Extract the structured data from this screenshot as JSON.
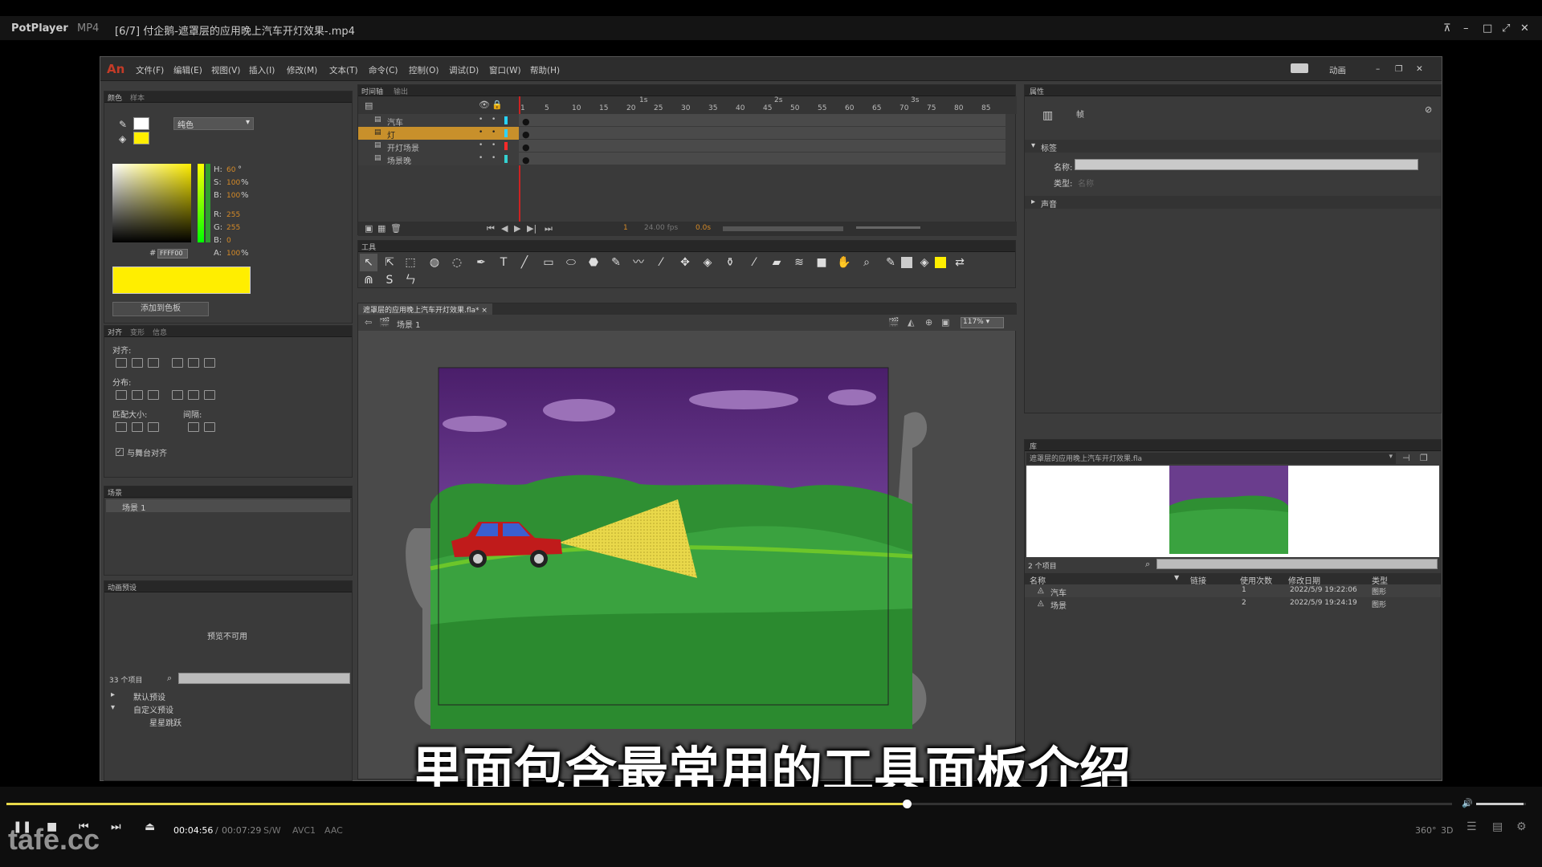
{
  "player": {
    "app_name": "PotPlayer",
    "format": "MP4",
    "file_title": "[6/7] 付企鹅-遮罩层的应用晚上汽车开灯效果-.mp4",
    "current_time": "00:04:56",
    "separator": "/",
    "total_time": "00:07:29",
    "tags": [
      "S/W",
      "AVC1",
      "AAC"
    ],
    "progress": 0.62,
    "volume": 0.95,
    "right_icons": [
      "360°",
      "3D"
    ],
    "subtitle": "里面包含最常用的工具面板介绍",
    "watermark": "tafe.cc"
  },
  "flash": {
    "logo": "An",
    "menus": [
      "文件(F)",
      "编辑(E)",
      "视图(V)",
      "插入(I)",
      "修改(M)",
      "文本(T)",
      "命令(C)",
      "控制(O)",
      "调试(D)",
      "窗口(W)",
      "帮助(H)"
    ],
    "workspace": "动画",
    "color_panel": {
      "tabs": [
        "颜色",
        "样本"
      ],
      "type": "纯色",
      "hsb": [
        {
          "k": "H:",
          "v": "60",
          "u": "°"
        },
        {
          "k": "S:",
          "v": "100",
          "u": "%"
        },
        {
          "k": "B:",
          "v": "100",
          "u": "%"
        }
      ],
      "rgb": [
        {
          "k": "R:",
          "v": "255"
        },
        {
          "k": "G:",
          "v": "255"
        },
        {
          "k": "B:",
          "v": "0"
        }
      ],
      "alpha": {
        "k": "A:",
        "v": "100",
        "u": "%"
      },
      "hex_label": "#",
      "hex": "FFFF00",
      "swatch_color": "#ffee00",
      "add_button": "添加到色板"
    },
    "align_panel": {
      "tabs": [
        "对齐",
        "变形",
        "信息"
      ],
      "align": "对齐:",
      "distribute": "分布:",
      "match_size": "匹配大小:",
      "spacing": "间隔:",
      "stage_align": "与舞台对齐"
    },
    "scene_panel": {
      "title": "场景",
      "item": "场景 1"
    },
    "motion_panel": {
      "title": "动画预设",
      "preview": "预览不可用",
      "count": "33 个项目",
      "tree": [
        "默认预设",
        "自定义预设",
        "星星跳跃"
      ]
    },
    "timeline": {
      "tabs": [
        "时间轴",
        "输出"
      ],
      "ticks": [
        "1",
        "5",
        "10",
        "15",
        "20",
        "25",
        "30",
        "35",
        "40",
        "45",
        "50",
        "55",
        "60",
        "65",
        "70",
        "75",
        "80",
        "85"
      ],
      "seconds": [
        "1s",
        "2s",
        "3s"
      ],
      "layers": [
        {
          "name": "汽车",
          "color": "#27d3ff"
        },
        {
          "name": "灯",
          "color": "#2fd3ff",
          "selected": true
        },
        {
          "name": "开灯场景",
          "color": "#ff2a2a"
        },
        {
          "name": "场景晚",
          "color": "#34d1d1"
        }
      ],
      "frame_num": "1",
      "fps": "24.00 fps",
      "time": "0.0s"
    },
    "tools_title": "工具",
    "doc_tab": "遮罩层的应用晚上汽车开灯效果.fla*",
    "scene_label": "场景 1",
    "zoom": "117%",
    "properties": {
      "title": "属性",
      "kind": "帧",
      "label_section": "标签",
      "name_label": "名称:",
      "type_label": "类型:",
      "type_value": "名称",
      "sound_section": "声音"
    },
    "library": {
      "title": "库",
      "file": "遮罩层的应用晚上汽车开灯效果.fla",
      "count": "2 个项目",
      "headers": [
        "名称",
        "链接",
        "使用次数",
        "修改日期",
        "类型"
      ],
      "items": [
        {
          "name": "汽车",
          "uses": "1",
          "date": "2022/5/9 19:22:06",
          "type": "图形"
        },
        {
          "name": "场景",
          "uses": "2",
          "date": "2022/5/9 19:24:19",
          "type": "图形"
        }
      ]
    }
  }
}
